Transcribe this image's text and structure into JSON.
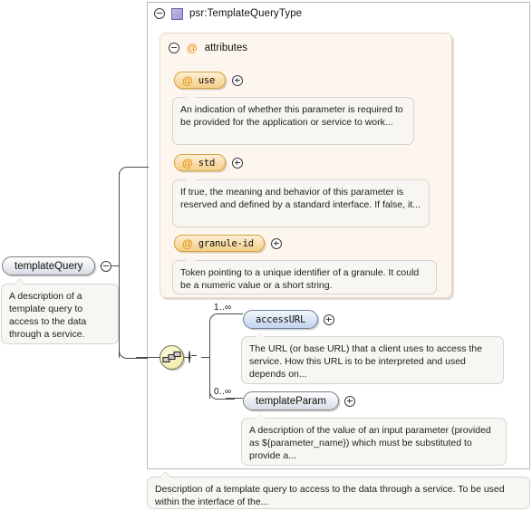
{
  "type_box": {
    "title": "psr:TemplateQueryType",
    "collapse_icon": "minus-circle-icon",
    "type_swatch_icon": "complex-type-swatch-icon"
  },
  "attributes_group": {
    "label": "attributes",
    "at_icon": "at-sign-icon",
    "collapse_icon": "minus-circle-icon",
    "items": [
      {
        "name": "use",
        "at_icon": "at-sign-icon",
        "expand_icon": "plus-circle-icon",
        "annotation": "An indication of whether this parameter is required to be provided for the application or service to work..."
      },
      {
        "name": "std",
        "at_icon": "at-sign-icon",
        "expand_icon": "plus-circle-icon",
        "annotation": "If true, the meaning and behavior of this parameter is reserved and defined by a standard interface. If false, it..."
      },
      {
        "name": "granule-id",
        "at_icon": "at-sign-icon",
        "expand_icon": "plus-circle-icon",
        "annotation": "Token pointing to a unique identifier of a granule. It could be a numeric value or a short string."
      }
    ]
  },
  "root_element": {
    "name": "templateQuery",
    "collapse_icon": "minus-circle-icon",
    "annotation": "A description of a template query to access to the data through a service."
  },
  "sequence": {
    "icon": "sequence-compositor-icon",
    "collapse_icon": "minus-circle-icon"
  },
  "children": [
    {
      "name": "accessURL",
      "occurrence": "1..∞",
      "expand_icon": "plus-circle-icon",
      "annotation": "The URL (or base URL) that a client uses to access the service. How this URL is to be interpreted and used depends on..."
    },
    {
      "name": "templateParam",
      "occurrence": "0..∞",
      "expand_icon": "plus-circle-icon",
      "annotation": "A description of the value of an input parameter (provided as ${parameter_name}) which must be substituted to provide a..."
    }
  ],
  "type_documentation": "Description of a template query to access to the data through a service. To be used within the interface of the...",
  "colors": {
    "attribute_fill": "#f8dda8",
    "attribute_border": "#d8a33f",
    "attribute_panel_bg": "#fdf6ee",
    "element_fill": "#eceef3",
    "element_blue_fill": "#dbe6f5",
    "sequence_fill": "#f5f0bc",
    "bubble_bg": "#f7f6f3",
    "line": "#4d4d4d",
    "type_swatch": "#b3a4dd"
  }
}
